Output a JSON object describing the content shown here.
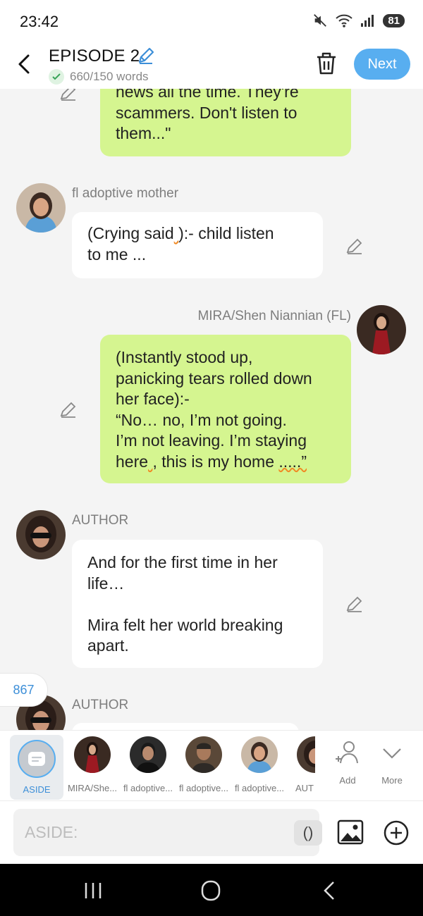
{
  "status": {
    "time": "23:42",
    "battery": "81"
  },
  "header": {
    "title": "EPISODE 2",
    "word_count": "660/150 words",
    "next_label": "Next"
  },
  "messages": [
    {
      "side": "right",
      "text": "news all the time. They're\nscammers. Don't listen to\nthem...\""
    },
    {
      "side": "left",
      "name": "fl adoptive mother",
      "text_a": "(Crying said",
      "text_b": "):- child listen\nto me ..."
    },
    {
      "side": "right",
      "name": "MIRA/Shen Niannian (FL)",
      "text_a": "(Instantly stood up,\npanicking tears rolled down\nher face):-\n“No… no, I’m not going.\nI’m not leaving. I’m staying\nhere",
      "text_b": ", this is my home ",
      "text_c": ".....”"
    },
    {
      "side": "left",
      "name": "AUTHOR",
      "text": "And for the first time in her\nlife…\n\nMira felt her world breaking\napart."
    },
    {
      "side": "left",
      "name": "AUTHOR"
    }
  ],
  "counter": "867",
  "characters": [
    {
      "label": "ASIDE"
    },
    {
      "label": "MIRA/She..."
    },
    {
      "label": "fl adoptive..."
    },
    {
      "label": "fl adoptive..."
    },
    {
      "label": "fl adoptive..."
    },
    {
      "label": "AUT"
    }
  ],
  "tools": {
    "add": "Add",
    "more": "More"
  },
  "input": {
    "placeholder": "ASIDE:",
    "paren": "()"
  },
  "colors": {
    "accent": "#58aef0",
    "green_bubble": "#d5f590"
  }
}
